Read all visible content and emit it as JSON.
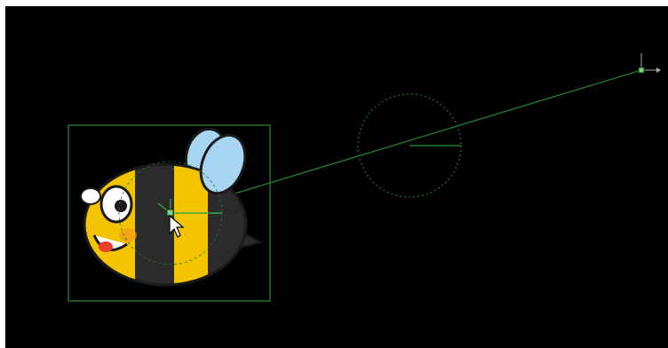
{
  "canvas": {
    "background": "#000000",
    "gizmo_color": "#1f7a2a",
    "gizmo_handle_color": "#7fd07f"
  },
  "layer": {
    "name": "bee-sprite",
    "colors": {
      "body_yellow": "#f5c400",
      "body_stripe": "#2b2b2b",
      "wing_fill": "#a8d6f2",
      "outline": "#1a1a1a",
      "tongue": "#e8402a"
    }
  },
  "tools": {
    "pointer": "arrow-cursor-icon",
    "motion_path_icon": "motion-path-icon",
    "anchor_icon": "anchor-point-icon",
    "target_icon": "target-point-icon"
  }
}
